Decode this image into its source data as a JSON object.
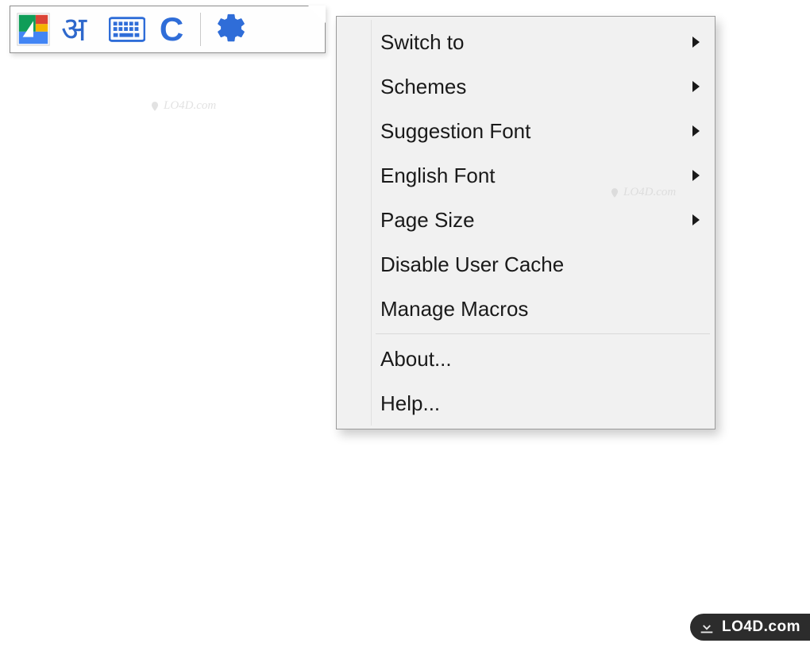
{
  "toolbar": {
    "language_glyph": "अ",
    "letter_button": "C"
  },
  "menu": {
    "items": [
      {
        "label": "Switch to",
        "submenu": true
      },
      {
        "label": "Schemes",
        "submenu": true
      },
      {
        "label": "Suggestion Font",
        "submenu": true
      },
      {
        "label": "English Font",
        "submenu": true
      },
      {
        "label": "Page Size",
        "submenu": true
      },
      {
        "label": "Disable User Cache",
        "submenu": false
      },
      {
        "label": "Manage Macros",
        "submenu": false
      },
      {
        "separator": true
      },
      {
        "label": "About...",
        "submenu": false
      },
      {
        "label": "Help...",
        "submenu": false
      }
    ]
  },
  "watermark_text": "LO4D.com",
  "footer_text": "LO4D.com"
}
